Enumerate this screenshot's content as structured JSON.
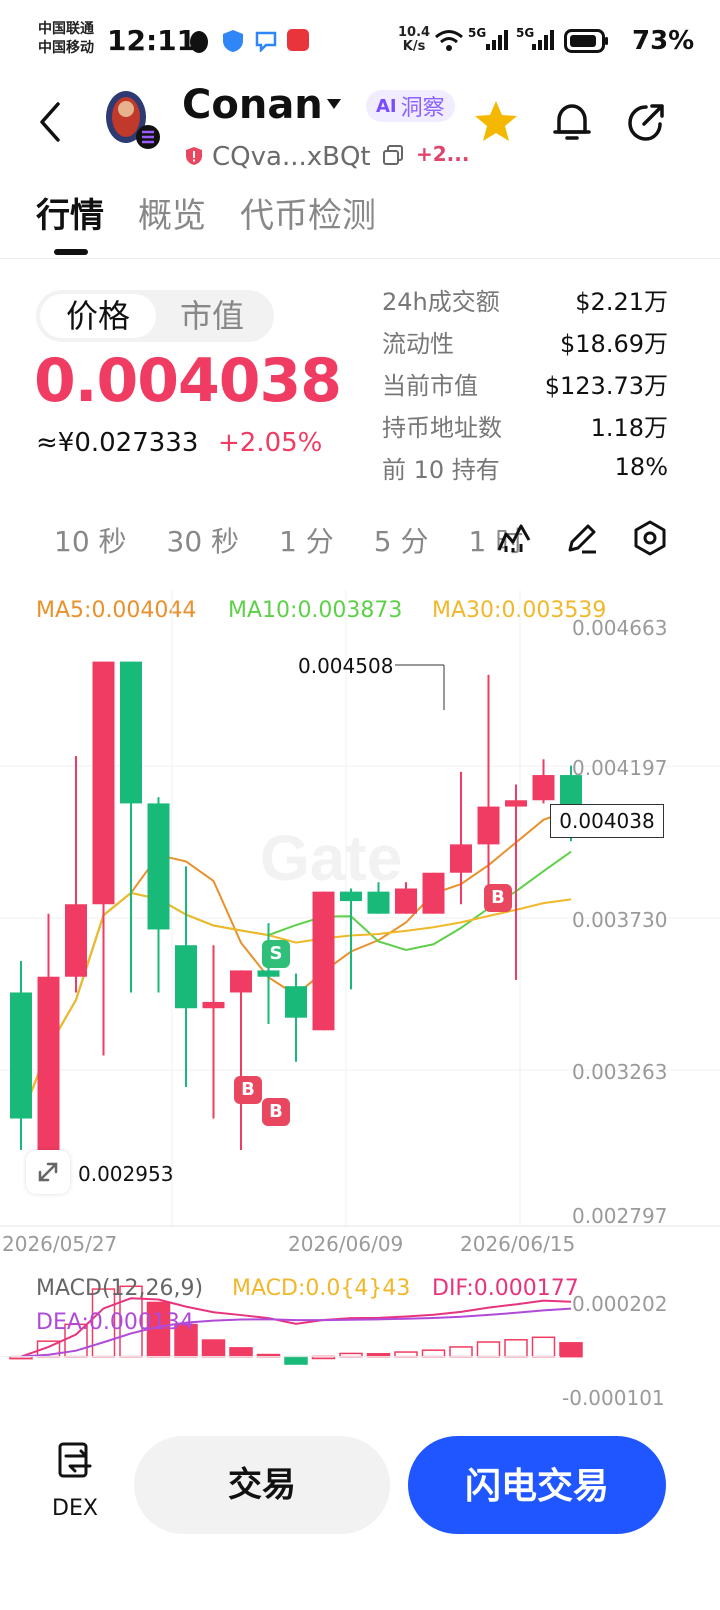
{
  "status_bar": {
    "carrier_1": "中国联通",
    "carrier_2": "中国移动",
    "time": "12:11",
    "net_speed_value": "10.4",
    "net_speed_unit": "K/s",
    "signal_1": "5G",
    "signal_2": "5G",
    "battery": "73%"
  },
  "header": {
    "token_name": "Conan",
    "ai_tag": "AI",
    "ai_label": "洞察",
    "address": "CQva...xBQt",
    "chain_more": "+2..."
  },
  "tabs": [
    {
      "label": "行情",
      "active": true
    },
    {
      "label": "概览",
      "active": false
    },
    {
      "label": "代币检测",
      "active": false
    }
  ],
  "price": {
    "toggle_price": "价格",
    "toggle_mcap": "市值",
    "value": "0.004038",
    "cny": "≈¥0.027333",
    "change": "+2.05%"
  },
  "stats": [
    {
      "label": "24h成交额",
      "value": "$2.21万"
    },
    {
      "label": "流动性",
      "value": "$18.69万"
    },
    {
      "label": "当前市值",
      "value": "$123.73万"
    },
    {
      "label": "持币地址数",
      "value": "1.18万"
    },
    {
      "label": "前 10 持有",
      "value": "18%"
    }
  ],
  "intervals": [
    "10 秒",
    "30 秒",
    "1 分",
    "5 分",
    "1 时"
  ],
  "colors": {
    "up": "#f03c62",
    "down": "#19b97a",
    "ma5": "#e8912d",
    "ma10": "#5ed04a",
    "ma30": "#f0b82a",
    "dif": "#e8347d",
    "dea": "#b04ad8",
    "accent": "#1f56ff"
  },
  "chart_data": {
    "type": "candlestick",
    "ma_legend": {
      "ma5": "MA5:0.004044",
      "ma10": "MA10:0.003873",
      "ma30": "MA30:0.003539"
    },
    "y_axis_ticks": [
      "0.004663",
      "0.004197",
      "0.003730",
      "0.003263",
      "0.002797"
    ],
    "ylim": [
      0.002797,
      0.004663
    ],
    "x_axis_ticks": [
      "2026/05/27",
      "2026/06/09",
      "2026/06/15"
    ],
    "high_label": "0.004508",
    "low_label": "0.002953",
    "last_price": "0.004038",
    "candles": [
      {
        "o": 0.0035,
        "c": 0.0031,
        "h": 0.0036,
        "l": 0.003
      },
      {
        "o": 0.003,
        "c": 0.00355,
        "h": 0.00375,
        "l": 0.00295
      },
      {
        "o": 0.00355,
        "c": 0.00378,
        "h": 0.00425,
        "l": 0.0035
      },
      {
        "o": 0.00378,
        "c": 0.00455,
        "h": 0.00455,
        "l": 0.0033
      },
      {
        "o": 0.00455,
        "c": 0.0041,
        "h": 0.00455,
        "l": 0.0035
      },
      {
        "o": 0.0041,
        "c": 0.0037,
        "h": 0.00412,
        "l": 0.0035
      },
      {
        "o": 0.00365,
        "c": 0.00345,
        "h": 0.0039,
        "l": 0.0032
      },
      {
        "o": 0.00345,
        "c": 0.00347,
        "h": 0.00365,
        "l": 0.0031
      },
      {
        "o": 0.0035,
        "c": 0.00357,
        "h": 0.00357,
        "l": 0.003
      },
      {
        "o": 0.00357,
        "c": 0.00355,
        "h": 0.00372,
        "l": 0.0034
      },
      {
        "o": 0.00352,
        "c": 0.00342,
        "h": 0.00356,
        "l": 0.00328
      },
      {
        "o": 0.00338,
        "c": 0.00382,
        "h": 0.00382,
        "l": 0.00338
      },
      {
        "o": 0.00382,
        "c": 0.00379,
        "h": 0.00383,
        "l": 0.00351
      },
      {
        "o": 0.00382,
        "c": 0.00375,
        "h": 0.00385,
        "l": 0.00375
      },
      {
        "o": 0.00375,
        "c": 0.00383,
        "h": 0.00385,
        "l": 0.00375
      },
      {
        "o": 0.00375,
        "c": 0.00388,
        "h": 0.00388,
        "l": 0.00375
      },
      {
        "o": 0.00388,
        "c": 0.00397,
        "h": 0.0042,
        "l": 0.00378
      },
      {
        "o": 0.00397,
        "c": 0.00409,
        "h": 0.004508,
        "l": 0.0038
      },
      {
        "o": 0.00409,
        "c": 0.00411,
        "h": 0.00416,
        "l": 0.00354
      },
      {
        "o": 0.00411,
        "c": 0.00419,
        "h": 0.00424,
        "l": 0.0041
      },
      {
        "o": 0.00419,
        "c": 0.004038,
        "h": 0.00422,
        "l": 0.00398
      }
    ],
    "markers": [
      {
        "label": "S",
        "kind": "s",
        "index": 10
      },
      {
        "label": "B",
        "kind": "b",
        "index": 8
      },
      {
        "label": "B",
        "kind": "b",
        "index": 9
      },
      {
        "label": "B",
        "kind": "b",
        "index": 18
      }
    ],
    "macd": {
      "legend_name": "MACD(12,26,9)",
      "legend_macd": "MACD:0.0{4}43",
      "legend_dif": "DIF:0.000177",
      "legend_dea": "DEA:0.000134",
      "y_ticks": [
        "0.000202",
        "-0.000101"
      ],
      "ylim": [
        -0.000101,
        0.000202
      ]
    }
  },
  "bottom_bar": {
    "dex_label": "DEX",
    "trade_label": "交易",
    "flash_label": "闪电交易"
  }
}
